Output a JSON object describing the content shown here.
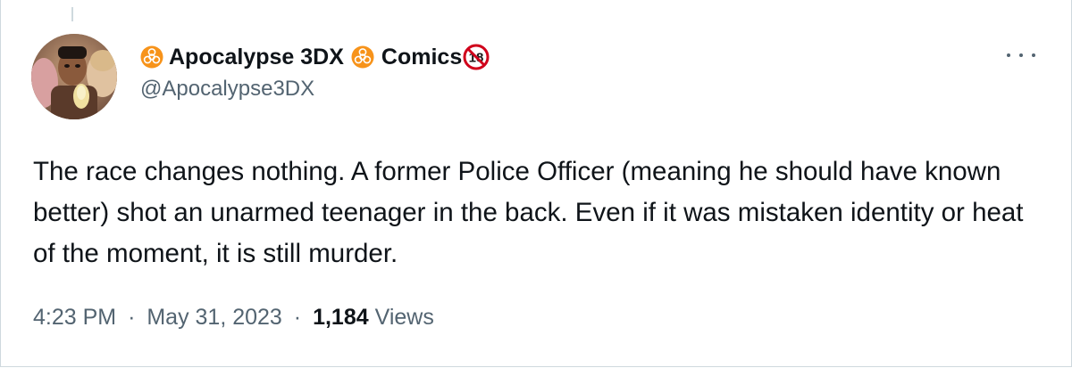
{
  "tweet": {
    "author": {
      "display_name_part1": "Apocalypse 3DX",
      "display_name_part2": "Comics",
      "handle": "@Apocalypse3DX",
      "badge_icon": "biohazard-icon",
      "age_badge": "18"
    },
    "text": "The race changes nothing. A former Police Officer (meaning he should have known better) shot an unarmed teenager in the back. Even if it was mistaken identity or heat of the moment, it is still murder.",
    "time": "4:23 PM",
    "separator": "·",
    "date": "May 31, 2023",
    "views_count": "1,184",
    "views_label": "Views"
  },
  "colors": {
    "badge": "#f7931a",
    "text_primary": "#0f1419",
    "text_secondary": "#536471"
  }
}
